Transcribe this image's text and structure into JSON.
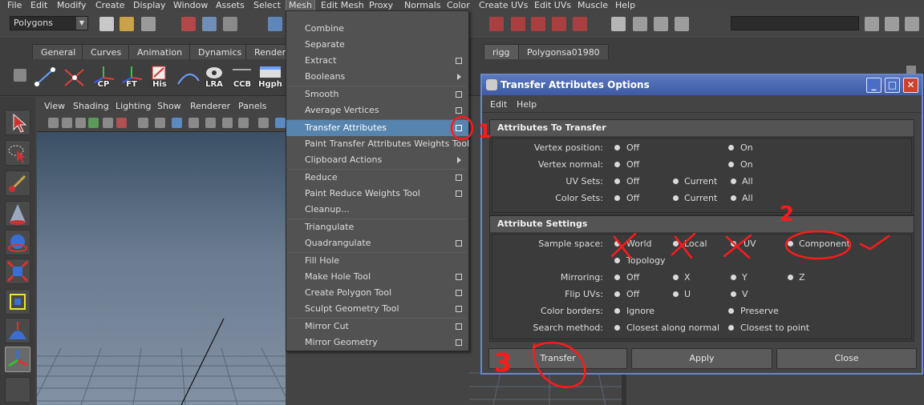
{
  "menubar": {
    "items": [
      "File",
      "Edit",
      "Modify",
      "Create",
      "Display",
      "Window",
      "Assets",
      "Select",
      "Mesh",
      "Edit Mesh",
      "Proxy",
      "Normals",
      "Color",
      "Create UVs",
      "Edit UVs",
      "Muscle",
      "Help"
    ]
  },
  "statusline": {
    "mode": "Polygons"
  },
  "shelf": {
    "tabs": [
      "General",
      "Curves",
      "Animation",
      "Dynamics",
      "Renderi",
      "rigg",
      "Polygonsa01980"
    ],
    "icons": [
      "",
      "",
      "CP",
      "FT",
      "His",
      "",
      "LRA",
      "CCB",
      "Hgph"
    ]
  },
  "viewport": {
    "menus": [
      "View",
      "Shading",
      "Lighting",
      "Show",
      "Renderer",
      "Panels"
    ]
  },
  "mesh_menu": {
    "items": [
      {
        "label": "Combine",
        "kind": "none"
      },
      {
        "label": "Separate",
        "kind": "none"
      },
      {
        "label": "Extract",
        "kind": "option"
      },
      {
        "label": "Booleans",
        "kind": "submenu"
      },
      {
        "label": "Smooth",
        "kind": "option"
      },
      {
        "label": "Average Vertices",
        "kind": "option"
      },
      {
        "label": "Transfer Attributes",
        "kind": "option",
        "highlighted": true
      },
      {
        "label": "Paint Transfer Attributes Weights Tool",
        "kind": "none"
      },
      {
        "label": "Clipboard Actions",
        "kind": "submenu"
      },
      {
        "label": "Reduce",
        "kind": "option"
      },
      {
        "label": "Paint Reduce Weights Tool",
        "kind": "option"
      },
      {
        "label": "Cleanup...",
        "kind": "none"
      },
      {
        "label": "Triangulate",
        "kind": "none"
      },
      {
        "label": "Quadrangulate",
        "kind": "option"
      },
      {
        "label": "Fill Hole",
        "kind": "none"
      },
      {
        "label": "Make Hole Tool",
        "kind": "option"
      },
      {
        "label": "Create Polygon Tool",
        "kind": "option"
      },
      {
        "label": "Sculpt Geometry Tool",
        "kind": "option"
      },
      {
        "label": "Mirror Cut",
        "kind": "option"
      },
      {
        "label": "Mirror Geometry",
        "kind": "option"
      }
    ]
  },
  "dialog": {
    "title": "Transfer Attributes Options",
    "menus": [
      "Edit",
      "Help"
    ],
    "section1": {
      "title": "Attributes To Transfer",
      "rows": [
        {
          "label": "Vertex position:",
          "options": [
            "Off",
            "On"
          ]
        },
        {
          "label": "Vertex normal:",
          "options": [
            "Off",
            "On"
          ]
        },
        {
          "label": "UV Sets:",
          "options": [
            "Off",
            "Current",
            "All"
          ]
        },
        {
          "label": "Color Sets:",
          "options": [
            "Off",
            "Current",
            "All"
          ]
        }
      ]
    },
    "section2": {
      "title": "Attribute Settings",
      "sample_space": {
        "label": "Sample space:",
        "options": [
          "World",
          "Local",
          "UV",
          "Component",
          "Topology"
        ]
      },
      "mirroring": {
        "label": "Mirroring:",
        "options": [
          "Off",
          "X",
          "Y",
          "Z"
        ]
      },
      "flip_uvs": {
        "label": "Flip UVs:",
        "options": [
          "Off",
          "U",
          "V"
        ]
      },
      "color_borders": {
        "label": "Color borders:",
        "options": [
          "Ignore",
          "Preserve"
        ]
      },
      "search_method": {
        "label": "Search method:",
        "options": [
          "Closest along normal",
          "Closest to point"
        ]
      }
    },
    "buttons": {
      "transfer": "Transfer",
      "apply": "Apply",
      "close": "Close"
    }
  },
  "annotations": {
    "one": "1",
    "two": "2",
    "three": "3",
    "color": "#ff1a1a"
  }
}
